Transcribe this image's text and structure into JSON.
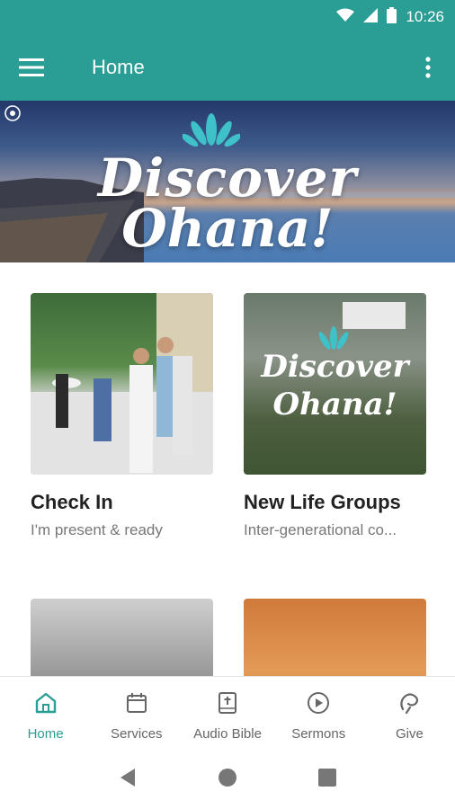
{
  "status_bar": {
    "time": "10:26"
  },
  "app_bar": {
    "title": "Home"
  },
  "hero": {
    "line1": "Discover",
    "line2": "Ohana!"
  },
  "cards": [
    {
      "title": "Check In",
      "subtitle": "I'm present & ready"
    },
    {
      "title": "New Life Groups",
      "subtitle": "Inter-generational co...",
      "overlay_line1": "Discover",
      "overlay_line2": "Ohana!"
    },
    {
      "title": "",
      "subtitle": ""
    },
    {
      "title": "",
      "subtitle": ""
    }
  ],
  "bottom_nav": [
    {
      "label": "Home",
      "icon": "home-icon"
    },
    {
      "label": "Services",
      "icon": "calendar-icon"
    },
    {
      "label": "Audio Bible",
      "icon": "bible-icon"
    },
    {
      "label": "Sermons",
      "icon": "play-icon"
    },
    {
      "label": "Give",
      "icon": "give-icon"
    }
  ],
  "colors": {
    "primary": "#2a9d95",
    "text": "#222222",
    "muted": "#777777"
  }
}
